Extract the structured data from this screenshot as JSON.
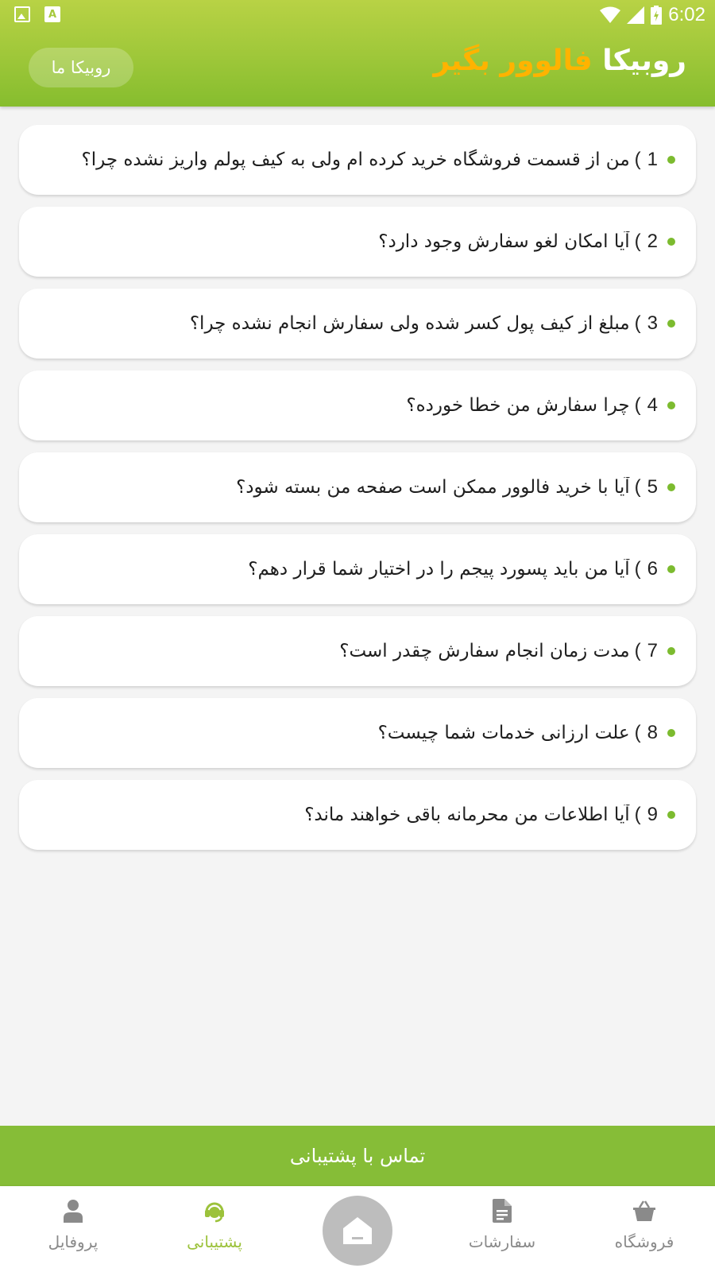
{
  "status_bar": {
    "time": "6:02",
    "left_icons": [
      "image-icon",
      "font-a-icon"
    ],
    "right_icons": [
      "wifi-icon",
      "signal-icon",
      "battery-charging-icon"
    ],
    "font_icon_letter": "A"
  },
  "header": {
    "title_part1": "روبیکا",
    "title_part2": "فالوور بگیر",
    "action_button_label": "روبیکا ما",
    "gradient_colors": [
      "#b8d245",
      "#86bd2e"
    ],
    "accent_color": "#ffb300"
  },
  "faq": {
    "items": [
      {
        "number": "1",
        "question": "من از قسمت فروشگاه خرید کرده ام ولی به کیف پولم واریز نشده چرا؟"
      },
      {
        "number": "2",
        "question": "آیا امکان لغو سفارش وجود دارد؟"
      },
      {
        "number": "3",
        "question": "مبلغ از کیف پول کسر شده ولی سفارش انجام نشده چرا؟"
      },
      {
        "number": "4",
        "question": "چرا سفارش من خطا خورده؟"
      },
      {
        "number": "5",
        "question": "آیا با خرید فالوور ممکن است صفحه من بسته شود؟"
      },
      {
        "number": "6",
        "question": "آیا من باید پسورد پیجم را در اختیار شما قرار دهم؟"
      },
      {
        "number": "7",
        "question": "مدت زمان انجام سفارش چقدر است؟"
      },
      {
        "number": "8",
        "question": "علت ارزانی خدمات شما چیست؟"
      },
      {
        "number": "9",
        "question": "آیا اطلاعات من محرمانه باقی خواهند ماند؟"
      }
    ],
    "bullet_color": "#7cbb2f"
  },
  "contact_button": {
    "label": "تماس با پشتیبانی",
    "color": "#86bd37"
  },
  "bottom_nav": {
    "shop": {
      "label": "فروشگاه",
      "icon": "shopping-basket-icon"
    },
    "orders": {
      "label": "سفارشات",
      "icon": "document-icon"
    },
    "home": {
      "icon": "home-icon"
    },
    "support": {
      "label": "پشتیبانی",
      "icon": "support-headset-icon",
      "active": true
    },
    "profile": {
      "label": "پروفایل",
      "icon": "person-icon"
    },
    "active_color": "#9cc23b",
    "inactive_color": "#8a8a8a"
  }
}
